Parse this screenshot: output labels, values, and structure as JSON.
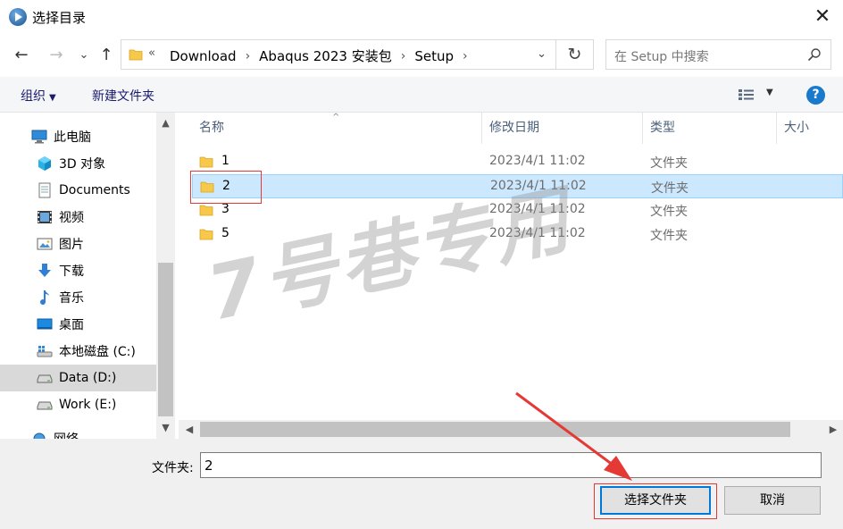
{
  "window": {
    "title": "选择目录",
    "close_glyph": "✕"
  },
  "nav": {
    "back_glyph": "←",
    "forward_glyph": "→",
    "recent_glyph": "⌄",
    "up_glyph": "↑"
  },
  "address": {
    "overflow_glyph": "«",
    "crumbs": [
      "Download",
      "Abaqus 2023 安装包",
      "Setup"
    ],
    "separator": "›"
  },
  "refresh_glyph": "↻",
  "search": {
    "placeholder": "在 Setup 中搜索"
  },
  "toolbar": {
    "organize_label": "组织",
    "new_folder_label": "新建文件夹",
    "help_label": "?"
  },
  "sidebar": {
    "items": [
      {
        "label": "此电脑",
        "icon": "computer-icon"
      },
      {
        "label": "3D 对象",
        "icon": "3d-objects-icon"
      },
      {
        "label": "Documents",
        "icon": "documents-icon"
      },
      {
        "label": "视频",
        "icon": "videos-icon"
      },
      {
        "label": "图片",
        "icon": "pictures-icon"
      },
      {
        "label": "下载",
        "icon": "downloads-icon"
      },
      {
        "label": "音乐",
        "icon": "music-icon"
      },
      {
        "label": "桌面",
        "icon": "desktop-icon"
      },
      {
        "label": "本地磁盘 (C:)",
        "icon": "drive-icon"
      },
      {
        "label": "Data (D:)",
        "icon": "drive-icon",
        "selected": true
      },
      {
        "label": "Work (E:)",
        "icon": "drive-icon"
      },
      {
        "label": "网络",
        "icon": "network-icon"
      }
    ]
  },
  "columns": {
    "name": "名称",
    "modified": "修改日期",
    "type": "类型",
    "size": "大小"
  },
  "files": [
    {
      "name": "1",
      "modified": "2023/4/1 11:02",
      "type": "文件夹"
    },
    {
      "name": "2",
      "modified": "2023/4/1 11:02",
      "type": "文件夹",
      "selected": true
    },
    {
      "name": "3",
      "modified": "2023/4/1 11:02",
      "type": "文件夹"
    },
    {
      "name": "5",
      "modified": "2023/4/1 11:02",
      "type": "文件夹"
    }
  ],
  "watermark": "7号巷专用",
  "bottom": {
    "folder_label": "文件夹:",
    "folder_value": "2",
    "ok_label": "选择文件夹",
    "cancel_label": "取消"
  },
  "colors": {
    "selection_fill": "#cce8ff",
    "selection_border": "#99d1ff",
    "annotation_red": "#e53935",
    "primary_button_border": "#0078d7",
    "folder_yellow": "#f8c84b"
  }
}
